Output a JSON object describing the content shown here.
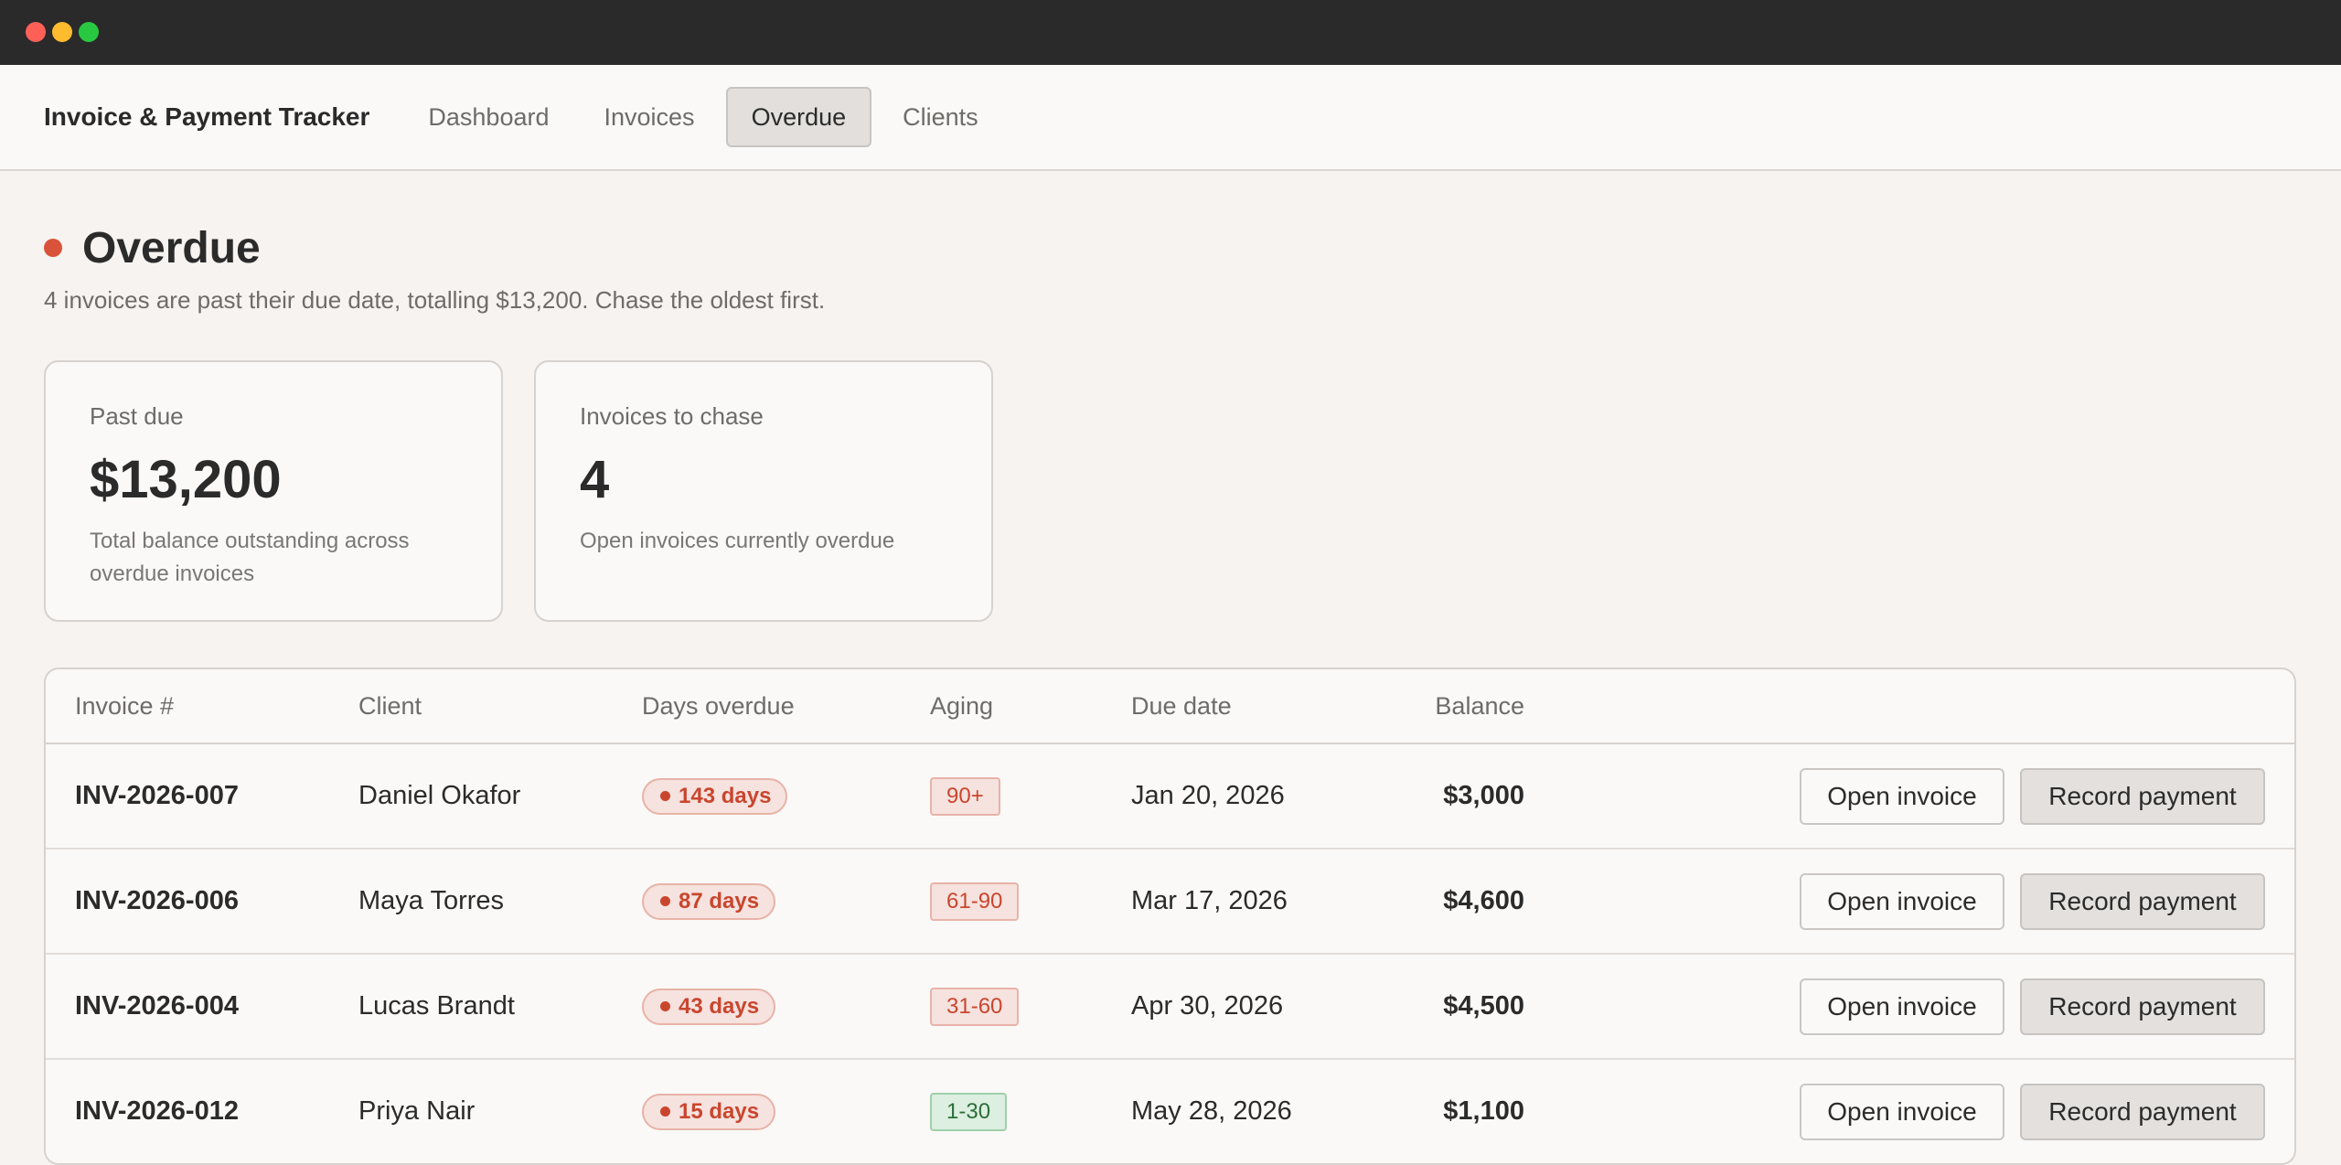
{
  "app": {
    "title": "Invoice & Payment Tracker"
  },
  "nav": {
    "tabs": [
      {
        "label": "Dashboard"
      },
      {
        "label": "Invoices"
      },
      {
        "label": "Overdue",
        "active": true
      },
      {
        "label": "Clients"
      }
    ]
  },
  "page": {
    "title": "Overdue",
    "subtitle": "4 invoices are past their due date, totalling $13,200. Chase the oldest first.",
    "status_color": "#d9533a"
  },
  "cards": [
    {
      "label": "Past due",
      "value": "$13,200",
      "description": "Total balance outstanding across overdue invoices"
    },
    {
      "label": "Invoices to chase",
      "value": "4",
      "description": "Open invoices currently overdue"
    }
  ],
  "table": {
    "headers": {
      "invoice": "Invoice #",
      "client": "Client",
      "days": "Days overdue",
      "aging": "Aging",
      "due": "Due date",
      "balance": "Balance"
    },
    "rows": [
      {
        "invoice": "INV-2026-007",
        "client": "Daniel Okafor",
        "days": "143 days",
        "aging": "90+",
        "aging_color": "red",
        "due": "Jan 20, 2026",
        "balance": "$3,000"
      },
      {
        "invoice": "INV-2026-006",
        "client": "Maya Torres",
        "days": "87 days",
        "aging": "61-90",
        "aging_color": "red",
        "due": "Mar 17, 2026",
        "balance": "$4,600"
      },
      {
        "invoice": "INV-2026-004",
        "client": "Lucas Brandt",
        "days": "43 days",
        "aging": "31-60",
        "aging_color": "red",
        "due": "Apr 30, 2026",
        "balance": "$4,500"
      },
      {
        "invoice": "INV-2026-012",
        "client": "Priya Nair",
        "days": "15 days",
        "aging": "1-30",
        "aging_color": "green",
        "due": "May 28, 2026",
        "balance": "$1,100"
      }
    ],
    "actions": {
      "open_label": "Open invoice",
      "record_label": "Record payment"
    }
  }
}
